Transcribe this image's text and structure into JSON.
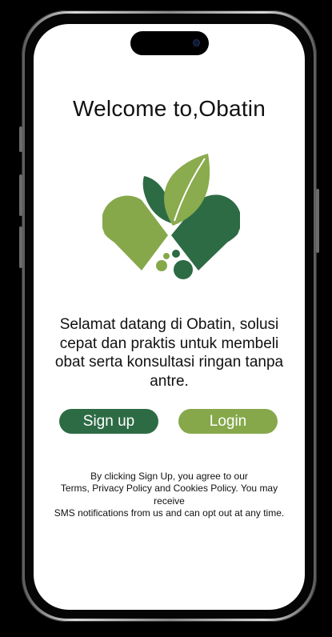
{
  "welcome": {
    "title": "Welcome to,Obatin"
  },
  "intro": {
    "description": "Selamat datang di Obatin, solusi cepat dan praktis untuk membeli obat serta konsultasi ringan tanpa antre."
  },
  "actions": {
    "signup_label": "Sign up",
    "login_label": "Login"
  },
  "legal": {
    "line1": "By clicking Sign Up, you agree to our",
    "line2": "Terms, Privacy Policy and Cookies Policy. You may receive",
    "line3": "SMS notifications from us and can opt out at any time."
  },
  "colors": {
    "dark_green": "#2d6b45",
    "light_green": "#86a84b",
    "logo_leaf_green": "#8aab4e"
  },
  "icons": {
    "logo": "obatin-capsule-leaf-logo"
  }
}
